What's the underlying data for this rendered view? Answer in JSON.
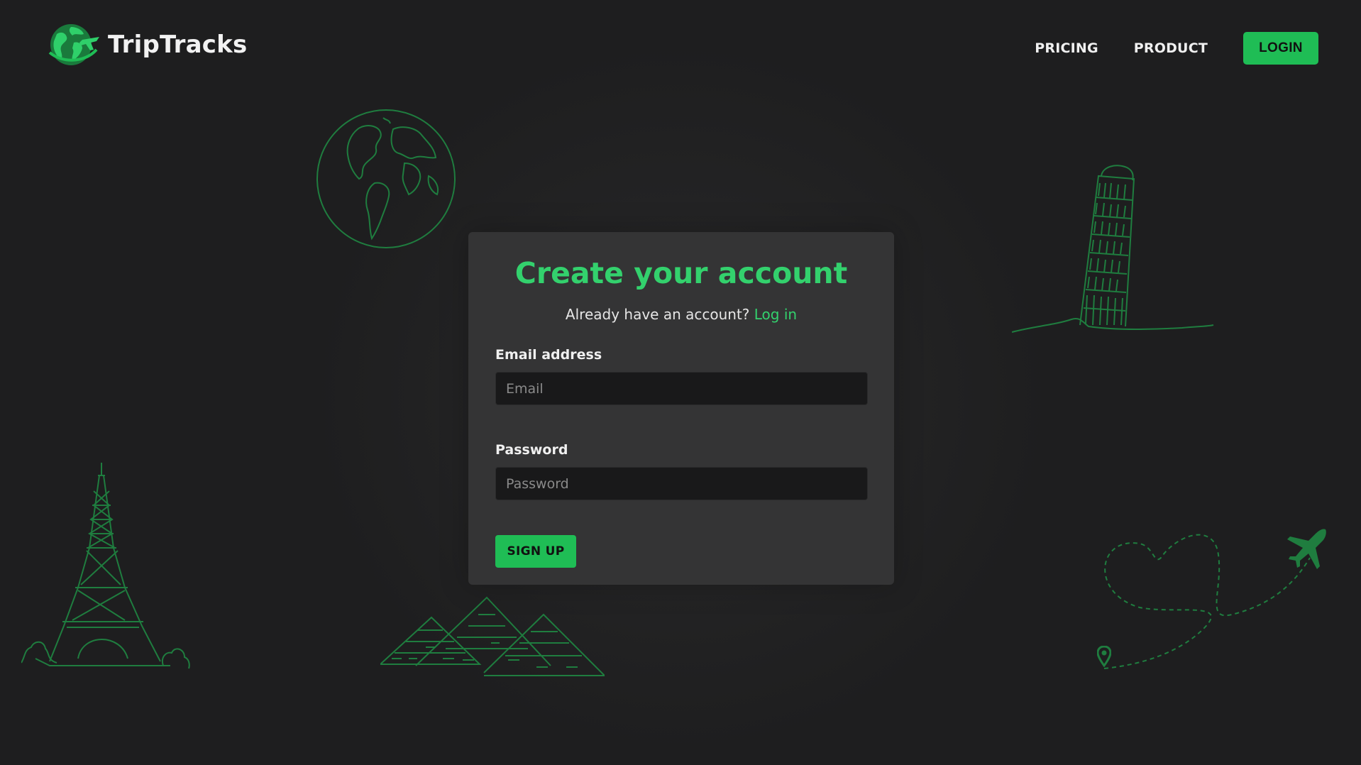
{
  "brand": {
    "name": "TripTracks",
    "logo_icon": "globe-plane-icon",
    "accent_color": "#1fbd55",
    "title_color": "#33d16d"
  },
  "nav": {
    "pricing": "PRICING",
    "product": "PRODUCT",
    "login": "LOGIN"
  },
  "signup": {
    "title": "Create your account",
    "subtitle_text": "Already have an account?",
    "subtitle_link": "Log in",
    "email_label": "Email address",
    "email_placeholder": "Email",
    "password_label": "Password",
    "password_placeholder": "Password",
    "submit_label": "SIGN UP"
  },
  "decorations": [
    "globe-icon",
    "leaning-tower-icon",
    "eiffel-tower-icon",
    "pyramids-icon",
    "heart-flight-path-icon",
    "airplane-icon",
    "location-pin-icon"
  ]
}
